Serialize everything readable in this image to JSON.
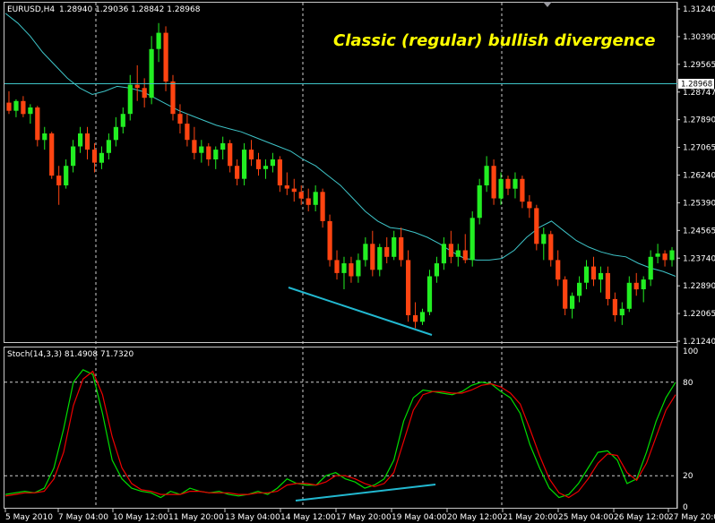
{
  "header": {
    "symbol_tf": "EURUSD,H4",
    "ohlc": "1.28940 1.29036 1.28842 1.28968"
  },
  "annotation": "Classic (regular) bullish divergence",
  "colors": {
    "bull": "#22ee22",
    "bear": "#ff4411",
    "ma": "#3ec4c8",
    "divergence": "#22b8d0",
    "stoch_main": "#00dd00",
    "stoch_signal": "#ee0000",
    "grid": "#d0d0d0",
    "frame": "#c8c8c8",
    "price_tag_bg": "#ffffff"
  },
  "stoch_header": "Stoch(14,3,3) 81.4908 71.7320",
  "chart_data": [
    {
      "type": "candlestick",
      "title": "EURUSD,H4",
      "ylim": [
        1.21,
        1.314
      ],
      "y_ticks": [
        "1.31240",
        "1.30390",
        "1.29565",
        "1.28747",
        "1.27890",
        "1.27065",
        "1.26240",
        "1.25390",
        "1.24565",
        "1.23740",
        "1.22890",
        "1.22065",
        "1.21240"
      ],
      "current_price": "1.28968",
      "x_ticks": [
        "5 May 2010",
        "7 May 04:00",
        "10 May 12:00",
        "11 May 20:00",
        "13 May 04:00",
        "14 May 12:00",
        "17 May 20:00",
        "19 May 04:00",
        "20 May 12:00",
        "21 May 20:00",
        "25 May 04:00",
        "26 May 12:00",
        "27 May 20:00"
      ],
      "series": [
        {
          "name": "ohlc",
          "values": [
            [
              1.2835,
              1.287,
              1.28,
              1.281
            ],
            [
              1.281,
              1.2845,
              1.279,
              1.284
            ],
            [
              1.284,
              1.2855,
              1.279,
              1.28
            ],
            [
              1.28,
              1.283,
              1.277,
              1.282
            ],
            [
              1.282,
              1.2825,
              1.27,
              1.272
            ],
            [
              1.272,
              1.276,
              1.269,
              1.274
            ],
            [
              1.274,
              1.2745,
              1.26,
              1.261
            ],
            [
              1.261,
              1.264,
              1.252,
              1.258
            ],
            [
              1.258,
              1.266,
              1.257,
              1.264
            ],
            [
              1.264,
              1.272,
              1.262,
              1.27
            ],
            [
              1.27,
              1.276,
              1.268,
              1.274
            ],
            [
              1.274,
              1.276,
              1.266,
              1.269
            ],
            [
              1.269,
              1.271,
              1.262,
              1.265
            ],
            [
              1.265,
              1.27,
              1.263,
              1.268
            ],
            [
              1.268,
              1.274,
              1.266,
              1.272
            ],
            [
              1.272,
              1.279,
              1.27,
              1.276
            ],
            [
              1.276,
              1.282,
              1.274,
              1.28
            ],
            [
              1.28,
              1.292,
              1.278,
              1.289
            ],
            [
              1.289,
              1.295,
              1.284,
              1.288
            ],
            [
              1.288,
              1.291,
              1.282,
              1.285
            ],
            [
              1.285,
              1.304,
              1.283,
              1.3
            ],
            [
              1.3,
              1.308,
              1.296,
              1.305
            ],
            [
              1.305,
              1.307,
              1.287,
              1.29
            ],
            [
              1.29,
              1.292,
              1.278,
              1.28
            ],
            [
              1.28,
              1.283,
              1.274,
              1.277
            ],
            [
              1.277,
              1.28,
              1.27,
              1.272
            ],
            [
              1.272,
              1.276,
              1.266,
              1.268
            ],
            [
              1.268,
              1.272,
              1.265,
              1.27
            ],
            [
              1.27,
              1.271,
              1.264,
              1.266
            ],
            [
              1.266,
              1.27,
              1.263,
              1.269
            ],
            [
              1.269,
              1.273,
              1.266,
              1.271
            ],
            [
              1.271,
              1.272,
              1.262,
              1.264
            ],
            [
              1.264,
              1.266,
              1.258,
              1.26
            ],
            [
              1.26,
              1.271,
              1.258,
              1.269
            ],
            [
              1.269,
              1.272,
              1.264,
              1.266
            ],
            [
              1.266,
              1.268,
              1.261,
              1.263
            ],
            [
              1.263,
              1.266,
              1.26,
              1.264
            ],
            [
              1.264,
              1.268,
              1.262,
              1.266
            ],
            [
              1.266,
              1.267,
              1.256,
              1.258
            ],
            [
              1.258,
              1.262,
              1.255,
              1.257
            ],
            [
              1.257,
              1.26,
              1.253,
              1.256
            ],
            [
              1.256,
              1.258,
              1.252,
              1.254
            ],
            [
              1.254,
              1.257,
              1.25,
              1.252
            ],
            [
              1.252,
              1.258,
              1.25,
              1.256
            ],
            [
              1.256,
              1.257,
              1.245,
              1.247
            ],
            [
              1.247,
              1.249,
              1.233,
              1.235
            ],
            [
              1.235,
              1.238,
              1.229,
              1.231
            ],
            [
              1.231,
              1.236,
              1.226,
              1.234
            ],
            [
              1.234,
              1.236,
              1.228,
              1.23
            ],
            [
              1.23,
              1.237,
              1.228,
              1.235
            ],
            [
              1.235,
              1.242,
              1.233,
              1.24
            ],
            [
              1.24,
              1.244,
              1.23,
              1.232
            ],
            [
              1.232,
              1.24,
              1.23,
              1.239
            ],
            [
              1.239,
              1.242,
              1.234,
              1.236
            ],
            [
              1.236,
              1.244,
              1.235,
              1.242
            ],
            [
              1.242,
              1.245,
              1.233,
              1.235
            ],
            [
              1.235,
              1.238,
              1.216,
              1.218
            ],
            [
              1.218,
              1.222,
              1.214,
              1.216
            ],
            [
              1.216,
              1.22,
              1.215,
              1.219
            ],
            [
              1.219,
              1.232,
              1.218,
              1.23
            ],
            [
              1.23,
              1.236,
              1.228,
              1.234
            ],
            [
              1.234,
              1.242,
              1.232,
              1.24
            ],
            [
              1.24,
              1.244,
              1.234,
              1.236
            ],
            [
              1.236,
              1.24,
              1.233,
              1.238
            ],
            [
              1.238,
              1.243,
              1.234,
              1.235
            ],
            [
              1.235,
              1.25,
              1.233,
              1.248
            ],
            [
              1.248,
              1.26,
              1.246,
              1.258
            ],
            [
              1.258,
              1.267,
              1.256,
              1.264
            ],
            [
              1.264,
              1.266,
              1.252,
              1.254
            ],
            [
              1.254,
              1.262,
              1.252,
              1.26
            ],
            [
              1.26,
              1.261,
              1.255,
              1.257
            ],
            [
              1.257,
              1.262,
              1.254,
              1.26
            ],
            [
              1.26,
              1.261,
              1.251,
              1.253
            ],
            [
              1.253,
              1.255,
              1.248,
              1.251
            ],
            [
              1.251,
              1.252,
              1.238,
              1.24
            ],
            [
              1.24,
              1.245,
              1.235,
              1.243
            ],
            [
              1.243,
              1.244,
              1.233,
              1.235
            ],
            [
              1.235,
              1.238,
              1.227,
              1.229
            ],
            [
              1.229,
              1.23,
              1.218,
              1.22
            ],
            [
              1.22,
              1.225,
              1.217,
              1.224
            ],
            [
              1.224,
              1.23,
              1.222,
              1.228
            ],
            [
              1.228,
              1.235,
              1.226,
              1.233
            ],
            [
              1.233,
              1.236,
              1.227,
              1.229
            ],
            [
              1.229,
              1.233,
              1.225,
              1.231
            ],
            [
              1.231,
              1.233,
              1.221,
              1.223
            ],
            [
              1.223,
              1.225,
              1.216,
              1.218
            ],
            [
              1.218,
              1.222,
              1.215,
              1.22
            ],
            [
              1.22,
              1.23,
              1.219,
              1.228
            ],
            [
              1.228,
              1.231,
              1.224,
              1.226
            ],
            [
              1.226,
              1.23,
              1.222,
              1.229
            ],
            [
              1.229,
              1.238,
              1.227,
              1.236
            ],
            [
              1.236,
              1.24,
              1.234,
              1.237
            ],
            [
              1.237,
              1.238,
              1.233,
              1.235
            ],
            [
              1.235,
              1.239,
              1.233,
              1.238
            ]
          ]
        },
        {
          "name": "ma",
          "values": [
            1.311,
            1.308,
            1.304,
            1.299,
            1.295,
            1.291,
            1.288,
            1.286,
            1.287,
            1.2885,
            1.288,
            1.287,
            1.285,
            1.283,
            1.281,
            1.2795,
            1.278,
            1.2765,
            1.2755,
            1.2745,
            1.273,
            1.2715,
            1.27,
            1.2685,
            1.266,
            1.264,
            1.261,
            1.258,
            1.254,
            1.25,
            1.247,
            1.245,
            1.2445,
            1.2435,
            1.242,
            1.24,
            1.2375,
            1.2355,
            1.235,
            1.235,
            1.2355,
            1.238,
            1.242,
            1.245,
            1.247,
            1.244,
            1.241,
            1.239,
            1.2375,
            1.2365,
            1.236,
            1.234,
            1.2325,
            1.2315,
            1.23
          ]
        }
      ]
    },
    {
      "type": "line",
      "title": "Stoch(14,3,3) 81.4908 71.7320",
      "ylim": [
        0,
        100
      ],
      "y_ticks": [
        "100",
        "80",
        "20",
        "0"
      ],
      "series": [
        {
          "name": "main",
          "values": [
            8,
            9,
            10,
            9,
            12,
            25,
            50,
            80,
            88,
            85,
            60,
            30,
            18,
            12,
            10,
            9,
            6,
            10,
            8,
            12,
            10,
            9,
            10,
            8,
            7,
            8,
            10,
            8,
            12,
            18,
            15,
            14,
            14,
            20,
            22,
            18,
            16,
            12,
            14,
            18,
            30,
            55,
            70,
            75,
            74,
            73,
            72,
            74,
            78,
            80,
            79,
            74,
            70,
            60,
            40,
            25,
            12,
            6,
            8,
            15,
            25,
            35,
            36,
            30,
            15,
            18,
            35,
            55,
            70,
            80
          ]
        },
        {
          "name": "signal",
          "values": [
            7,
            8,
            9,
            9,
            10,
            18,
            35,
            65,
            82,
            87,
            72,
            45,
            25,
            15,
            11,
            10,
            8,
            8,
            8,
            10,
            10,
            9,
            9,
            9,
            8,
            8,
            9,
            9,
            10,
            14,
            15,
            15,
            14,
            16,
            20,
            20,
            18,
            15,
            13,
            15,
            22,
            42,
            62,
            72,
            74,
            74,
            73,
            73,
            75,
            78,
            79,
            77,
            73,
            66,
            50,
            33,
            18,
            9,
            6,
            10,
            18,
            28,
            34,
            33,
            22,
            17,
            28,
            45,
            62,
            72
          ]
        }
      ]
    }
  ]
}
